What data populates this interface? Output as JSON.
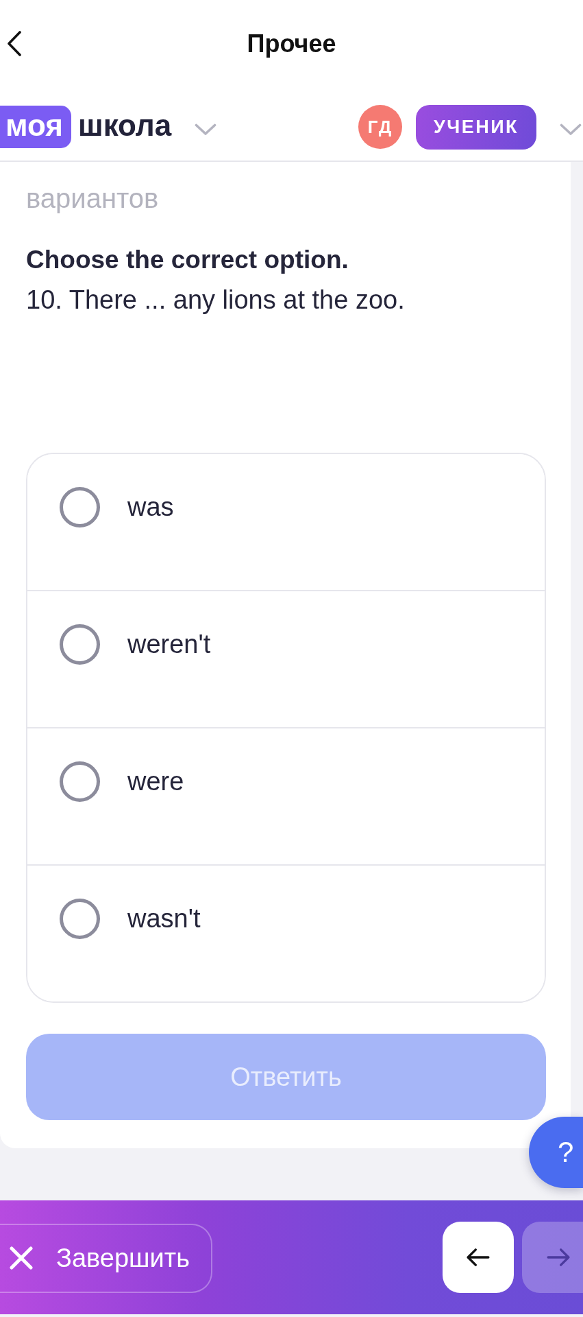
{
  "top_bar": {
    "title": "Прочее"
  },
  "header": {
    "logo": {
      "highlight": "моя",
      "text": "школа"
    },
    "avatar": {
      "initials": "ГД"
    },
    "role": "УЧЕНИК"
  },
  "question": {
    "hint": "вариантов",
    "instruction": "Choose the correct option.",
    "text": "10. There ... any lions at the zoo."
  },
  "options": [
    {
      "label": "was",
      "selected": false
    },
    {
      "label": "weren't",
      "selected": false
    },
    {
      "label": "were",
      "selected": false
    },
    {
      "label": "wasn't",
      "selected": false
    }
  ],
  "submit": {
    "label": "Ответить",
    "disabled": true
  },
  "help": {
    "label": "?"
  },
  "footer": {
    "finish": {
      "label": "Завершить"
    },
    "prev_button": {
      "disabled": false
    },
    "next_button": {
      "disabled": true
    }
  }
}
